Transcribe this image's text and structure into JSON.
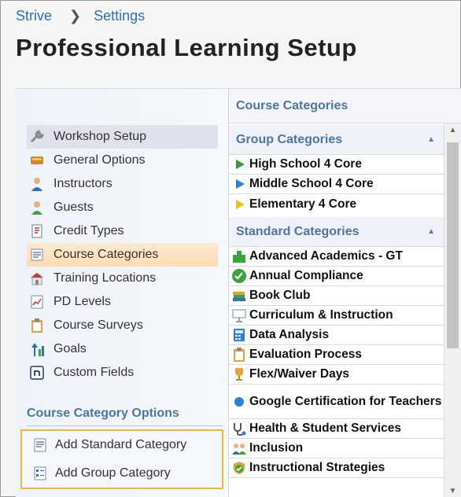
{
  "breadcrumb": {
    "root": "Strive",
    "current": "Settings"
  },
  "page_title": "Professional Learning Setup",
  "nav": {
    "items": [
      {
        "label": "Workshop Setup",
        "icon": "wrench-icon",
        "state": "gray"
      },
      {
        "label": "General Options",
        "icon": "options-icon",
        "state": ""
      },
      {
        "label": "Instructors",
        "icon": "instructor-icon",
        "state": ""
      },
      {
        "label": "Guests",
        "icon": "guest-icon",
        "state": ""
      },
      {
        "label": "Credit Types",
        "icon": "credit-icon",
        "state": ""
      },
      {
        "label": "Course Categories",
        "icon": "list-icon",
        "state": "orange"
      },
      {
        "label": "Training Locations",
        "icon": "building-icon",
        "state": ""
      },
      {
        "label": "PD Levels",
        "icon": "chart-icon",
        "state": ""
      },
      {
        "label": "Course Surveys",
        "icon": "clipboard-icon",
        "state": ""
      },
      {
        "label": "Goals",
        "icon": "goals-icon",
        "state": ""
      },
      {
        "label": "Custom Fields",
        "icon": "custom-field-icon",
        "state": ""
      }
    ]
  },
  "options": {
    "header": "Course Category Options",
    "items": [
      {
        "label": "Add Standard Category",
        "icon": "add-standard-icon"
      },
      {
        "label": "Add Group Category",
        "icon": "add-group-icon"
      }
    ]
  },
  "right_panel": {
    "title": "Course Categories",
    "group_header": "Group Categories",
    "group_items": [
      {
        "label": "High School 4 Core",
        "color": "#2e9e3a"
      },
      {
        "label": "Middle School 4 Core",
        "color": "#2d7fd8"
      },
      {
        "label": "Elementary 4 Core",
        "color": "#e7c21d"
      }
    ],
    "standard_header": "Standard Categories",
    "standard_items": [
      {
        "label": "Advanced Academics - GT",
        "icon": "puzzle-icon"
      },
      {
        "label": "Annual Compliance",
        "icon": "check-circle-icon"
      },
      {
        "label": "Book Club",
        "icon": "books-icon"
      },
      {
        "label": "Curriculum & Instruction",
        "icon": "presentation-icon"
      },
      {
        "label": "Data Analysis",
        "icon": "calculator-icon"
      },
      {
        "label": "Evaluation Process",
        "icon": "clipboard-icon"
      },
      {
        "label": "Flex/Waiver Days",
        "icon": "trophy-icon"
      },
      {
        "label": "Google Certification for Teachers",
        "icon": "blue-dot-icon"
      },
      {
        "label": "Health & Student Services",
        "icon": "stethoscope-icon"
      },
      {
        "label": "Inclusion",
        "icon": "people-icon"
      },
      {
        "label": "Instructional Strategies",
        "icon": "shield-check-icon"
      }
    ]
  }
}
